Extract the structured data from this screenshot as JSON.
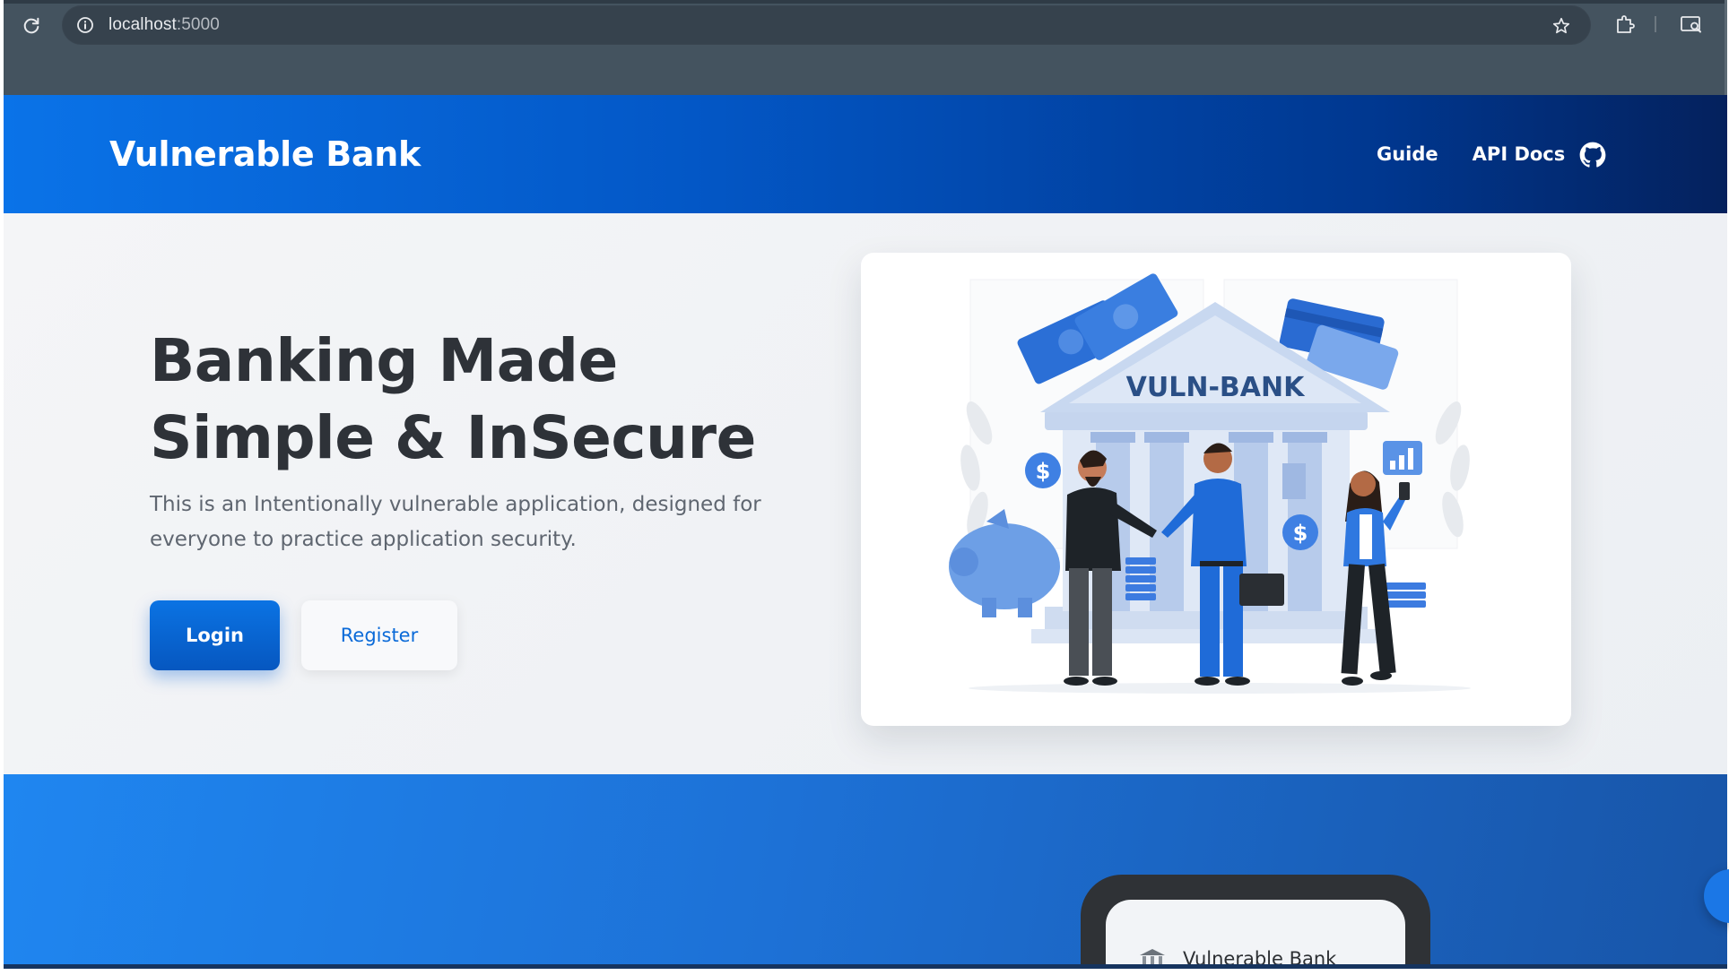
{
  "browser": {
    "url_host": "localhost",
    "url_port": ":5000",
    "icons": [
      "reload-icon",
      "site-info-icon",
      "bookmark-star-icon",
      "extensions-icon",
      "cast-search-icon"
    ]
  },
  "nav": {
    "brand": "Vulnerable Bank",
    "links": [
      "Guide",
      "API Docs"
    ],
    "github_icon": "github-icon"
  },
  "hero": {
    "title": "Banking Made Simple & InSecure",
    "description": "This is an Intentionally vulnerable application, designed for everyone to practice application security.",
    "login_label": "Login",
    "register_label": "Register",
    "illustration_sign": "VULN-BANK"
  },
  "feature": {
    "phone_brand": "Vulnerable Bank"
  },
  "colors": {
    "nav_start": "#0a73e8",
    "nav_end": "#04215d",
    "primary": "#0a6ad8",
    "feature_blue": "#1d71d6",
    "hero_text": "#2e3238"
  }
}
